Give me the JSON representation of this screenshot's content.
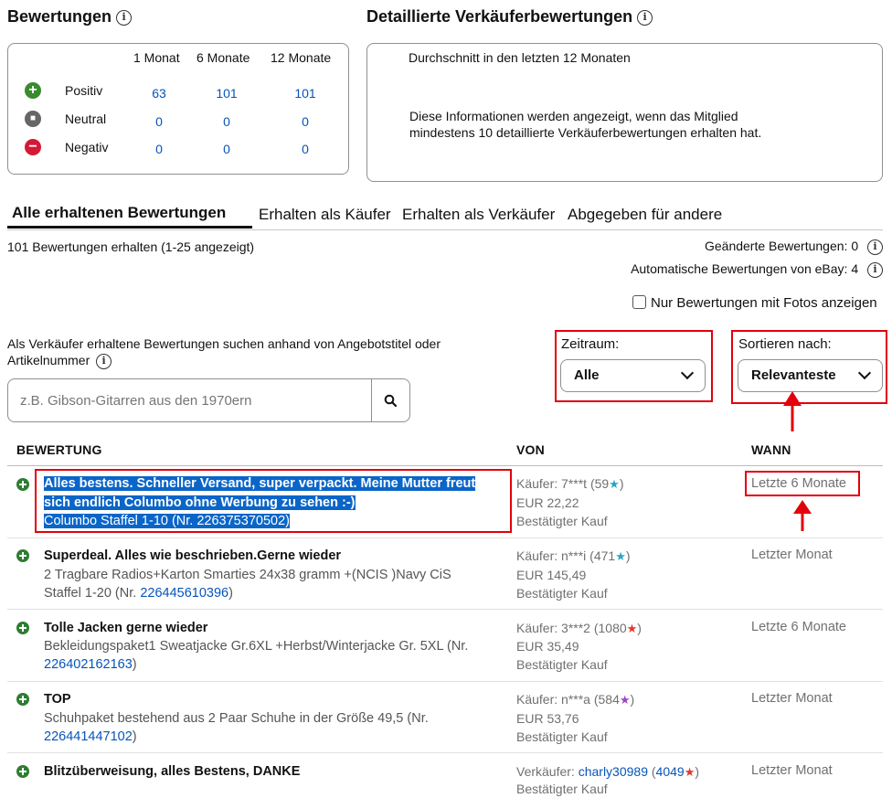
{
  "ratings": {
    "title": "Bewertungen",
    "cols": [
      "1 Monat",
      "6 Monate",
      "12 Monate"
    ],
    "rows": [
      {
        "label": "Positiv",
        "values": [
          "63",
          "101",
          "101"
        ]
      },
      {
        "label": "Neutral",
        "values": [
          "0",
          "0",
          "0"
        ]
      },
      {
        "label": "Negativ",
        "values": [
          "0",
          "0",
          "0"
        ]
      }
    ]
  },
  "detailed": {
    "title": "Detaillierte Verkäuferbewertungen",
    "subtitle": "Durchschnitt in den letzten 12 Monaten",
    "message_line1": "Diese Informationen werden angezeigt, wenn das Mitglied",
    "message_line2": "mindestens 10 detaillierte Verkäuferbewertungen erhalten hat."
  },
  "tabs": [
    "Alle erhaltenen Bewertungen",
    "Erhalten als Käufer",
    "Erhalten als Verkäufer",
    "Abgegeben für andere"
  ],
  "summary": {
    "count_text": "101 Bewertungen erhalten (1-25 angezeigt)",
    "changed": "Geänderte Bewertungen: 0",
    "automatic": "Automatische Bewertungen von eBay: 4",
    "photos_only": "Nur Bewertungen mit Fotos anzeigen"
  },
  "search": {
    "label_line1": "Als Verkäufer erhaltene Bewertungen suchen anhand von Angebotstitel oder",
    "label_line2": "Artikelnummer",
    "placeholder": "z.B. Gibson-Gitarren aus den 1970ern"
  },
  "filters": {
    "period_label": "Zeitraum:",
    "period_value": "Alle",
    "sort_label": "Sortieren nach:",
    "sort_value": "Relevanteste"
  },
  "table": {
    "headers": [
      "BEWERTUNG",
      "VON",
      "WANN"
    ],
    "rows": [
      {
        "title_line1": "Alles bestens. Schneller Versand, super verpackt. Meine Mutter freut",
        "title_line2": "sich endlich Columbo ohne Werbung zu sehen :-)",
        "item": "Columbo Staffel 1-10 (Nr. 226375370502)",
        "buyer": "Käufer: 7***t (59",
        "buyer_end": ")",
        "star_color": "#2aa3c9",
        "price": "EUR 22,22",
        "verified": "Bestätigter Kauf",
        "when": "Letzte 6 Monate"
      },
      {
        "title": "Superdeal. Alles wie beschrieben.Gerne wieder",
        "item_line1": "2 Tragbare Radios+Karton Smarties 24x38 gramm +(NCIS )Navy CiS",
        "item_line2_pre": "Staffel 1-20 (Nr. ",
        "item_num": "226445610396",
        "item_line2_post": ")",
        "buyer": "Käufer: n***i (471",
        "buyer_end": ")",
        "star_color": "#2aa3c9",
        "price": "EUR 145,49",
        "verified": "Bestätigter Kauf",
        "when": "Letzter Monat"
      },
      {
        "title": "Tolle Jacken gerne wieder",
        "item_line1": "Bekleidungspaket1 Sweatjacke Gr.6XL +Herbst/Winterjacke Gr. 5XL (Nr.",
        "item_num": "226402162163",
        "item_line2_post": ")",
        "buyer": "Käufer: 3***2 (1080",
        "buyer_end": ")",
        "star_color": "#e2372a",
        "price": "EUR 35,49",
        "verified": "Bestätigter Kauf",
        "when": "Letzte 6 Monate"
      },
      {
        "title": "TOP",
        "item_line1": "Schuhpaket bestehend aus 2 Paar Schuhe in der Größe 49,5 (Nr.",
        "item_num": "226441447102",
        "item_line2_post": ")",
        "buyer": "Käufer: n***a (584",
        "buyer_end": ")",
        "star_color": "#9c45c9",
        "price": "EUR 53,76",
        "verified": "Bestätigter Kauf",
        "when": "Letzter Monat"
      },
      {
        "title": "Blitzüberweisung, alles Bestens, DANKE",
        "seller_label": "Verkäufer: ",
        "seller_name": "charly30989",
        "seller_score": "4049",
        "star_color": "#e2372a",
        "verified": "Bestätigter Kauf",
        "when": "Letzter Monat"
      }
    ]
  },
  "star_glyph": "★",
  "info_glyph": "i",
  "search_icon": "search-icon"
}
